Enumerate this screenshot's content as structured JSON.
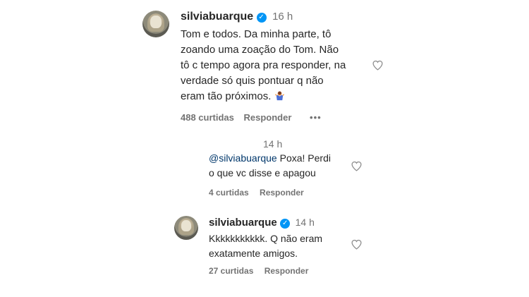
{
  "comment1": {
    "username": "silviabuarque",
    "time": "16 h",
    "lines": [
      "Tom e todos. Da minha parte, tô",
      "zoando uma zoação do Tom. Não",
      "tô c tempo agora pra responder, na",
      "verdade só quis pontuar q não",
      "eram tão próximos."
    ],
    "emoji": "person-shrugging-emoji",
    "likes": "488 curtidas",
    "reply": "Responder",
    "more": "•••"
  },
  "reply1": {
    "time": "14 h",
    "mention": "@silviabuarque",
    "text_line1": " Poxa! Perdi",
    "text_line2": "o que vc disse e apagou",
    "likes": "4 curtidas",
    "reply": "Responder"
  },
  "reply2": {
    "username": "silviabuarque",
    "time": "14 h",
    "lines": [
      "Kkkkkkkkkkk. Q não eram",
      "exatamente amigos."
    ],
    "likes": "27 curtidas",
    "reply": "Responder"
  },
  "colors": {
    "verified": "#0095f6",
    "mention": "#00376b",
    "secondary_text": "#737373"
  }
}
